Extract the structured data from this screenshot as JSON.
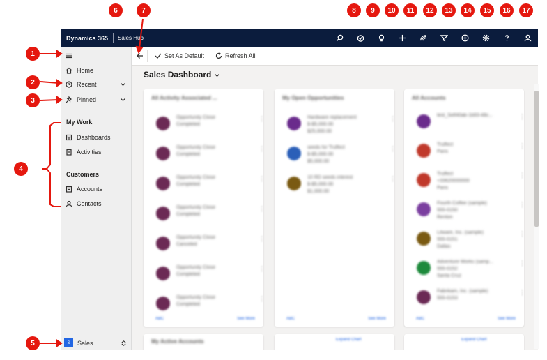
{
  "topbar": {
    "brand": "Dynamics 365",
    "app_name": "Sales Hub",
    "icons": [
      "search-icon",
      "task-icon",
      "lightbulb-icon",
      "add-icon",
      "assistant-icon",
      "filter-icon",
      "help-circle-icon",
      "settings-icon",
      "question-icon",
      "user-icon"
    ]
  },
  "sidebar": {
    "menu_icon": "hamburger-icon",
    "home": "Home",
    "recent": "Recent",
    "pinned": "Pinned",
    "my_work_header": "My Work",
    "dashboards": "Dashboards",
    "activities": "Activities",
    "customers_header": "Customers",
    "accounts": "Accounts",
    "contacts": "Contacts",
    "area_badge": "S",
    "area_label": "Sales"
  },
  "command_bar": {
    "set_default": "Set As Default",
    "refresh_all": "Refresh All"
  },
  "dashboard": {
    "title": "Sales Dashboard",
    "panel1": {
      "title": "All Activity Associated ...",
      "records": [
        {
          "l1": "Opportunity Close",
          "l2": "Completed",
          "color": "#6b2a55"
        },
        {
          "l1": "Opportunity Close",
          "l2": "Completed",
          "color": "#6b2a55"
        },
        {
          "l1": "Opportunity Close",
          "l2": "Completed",
          "color": "#6b2a55"
        },
        {
          "l1": "Opportunity Close",
          "l2": "Completed",
          "color": "#6b2a55"
        },
        {
          "l1": "Opportunity Close",
          "l2": "Canceled",
          "color": "#6b2a55"
        },
        {
          "l1": "Opportunity Close",
          "l2": "Completed",
          "color": "#6b2a55"
        },
        {
          "l1": "Opportunity Close",
          "l2": "Completed",
          "color": "#6b2a55"
        }
      ],
      "footer_left": "ABC",
      "footer_right": "See More"
    },
    "panel2": {
      "title": "My Open Opportunities",
      "records": [
        {
          "l1": "Hardware replacement",
          "l2": "$-$5,000.00",
          "l3": "$25,000.00",
          "color": "#6a2b8c"
        },
        {
          "l1": "seeds for Truffect",
          "l2": "$-$5,000.00",
          "l3": "$5,000.00",
          "color": "#2b5fb8"
        },
        {
          "l1": "10 RD seeds interest",
          "l2": "$-$5,000.00",
          "l3": "$1,000.00",
          "color": "#7a5a12"
        }
      ],
      "footer_left": "ABC",
      "footer_right": "See More"
    },
    "panel3": {
      "title": "All Accounts",
      "records": [
        {
          "l1": "test_Self40ab-1b93-48c...",
          "l2": "",
          "color": "#6a2b8c"
        },
        {
          "l1": "Truffect",
          "l2": "Paris",
          "color": "#c0392b"
        },
        {
          "l1": "Truffect",
          "l2": "+33620000000",
          "l3": "Paris",
          "color": "#c0392b"
        },
        {
          "l1": "Fourth Coffee (sample)",
          "l2": "555-0150",
          "l3": "Renton",
          "color": "#7b3fa0"
        },
        {
          "l1": "Litware, Inc. (sample)",
          "l2": "555-0151",
          "l3": "Dallas",
          "color": "#7a5a12"
        },
        {
          "l1": "Adventure Works (samp...",
          "l2": "555-0152",
          "l3": "Santa Cruz",
          "color": "#1e8a3c"
        },
        {
          "l1": "Fabrikam, Inc. (sample)",
          "l2": "555-0153",
          "l3": "",
          "color": "#6b2a55"
        }
      ],
      "footer_left": "ABC",
      "footer_right": "See More"
    },
    "panel4_title": "My Active Accounts",
    "expand_chart": "Expand Chart"
  },
  "callouts": [
    "1",
    "2",
    "3",
    "4",
    "5",
    "6",
    "7",
    "8",
    "9",
    "10",
    "11",
    "12",
    "13",
    "14",
    "15",
    "16",
    "17"
  ]
}
